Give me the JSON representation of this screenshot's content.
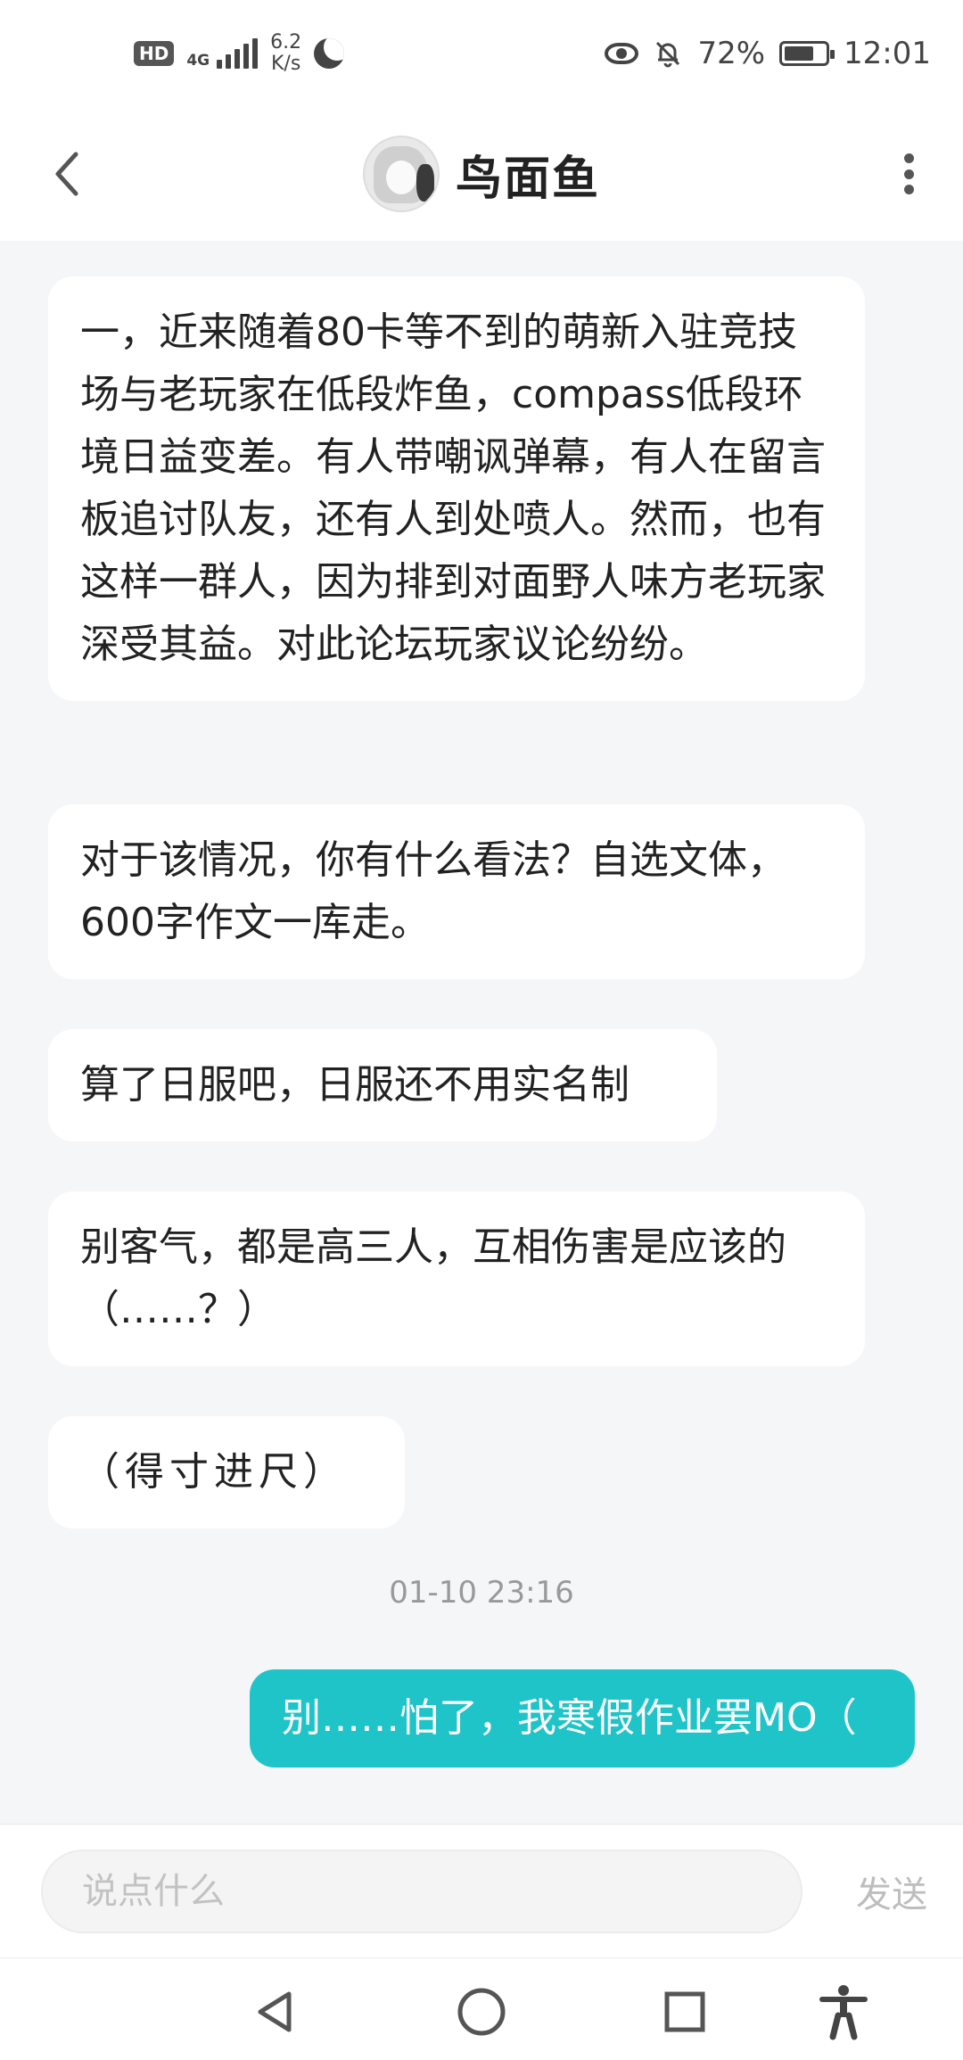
{
  "status_bar": {
    "hd": "HD",
    "network": "4G",
    "speed_value": "6.2",
    "speed_unit": "K/s",
    "battery_percent": "72%",
    "battery_level": 0.72,
    "time": "12:01"
  },
  "header": {
    "title": "鸟面鱼"
  },
  "messages": [
    {
      "direction": "incoming",
      "text": "一，近来随着80卡等不到的萌新入驻竞技场与老玩家在低段炸鱼，compass低段环境日益变差。有人带嘲讽弹幕，有人在留言板追讨队友，还有人到处喷人。然而，也有这样一群人，因为排到对面野人味方老玩家深受其益。对此论坛玩家议论纷纷。"
    },
    {
      "direction": "incoming",
      "text": "对于该情况，你有什么看法？自选文体，600字作文一库走。"
    },
    {
      "direction": "incoming",
      "text": "算了日服吧，日服还不用实名制"
    },
    {
      "direction": "incoming",
      "text": "别客气，都是高三人，互相伤害是应该的（……？）"
    },
    {
      "direction": "incoming",
      "text": "（得寸进尺）"
    },
    {
      "direction": "outgoing",
      "text": "别……怕了，我寒假作业罢MO（"
    }
  ],
  "timestamp": "01-10 23:16",
  "input": {
    "placeholder": "说点什么",
    "value": "",
    "send_label": "发送"
  },
  "colors": {
    "accent": "#1fc4c9",
    "background": "#f5f6f8",
    "bubble_incoming": "#ffffff"
  },
  "icons": {
    "back": "chevron-left-icon",
    "more": "more-vertical-icon",
    "nav": [
      "nav-back-icon",
      "nav-home-icon",
      "nav-recent-icon",
      "accessibility-icon"
    ]
  }
}
